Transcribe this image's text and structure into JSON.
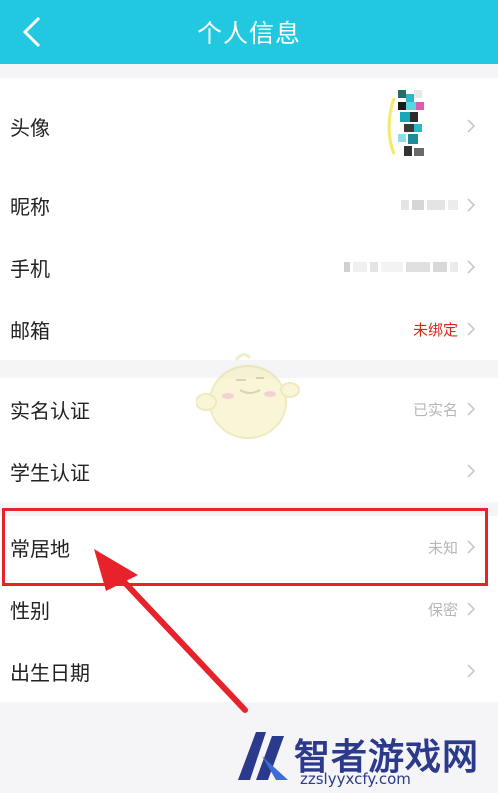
{
  "header": {
    "title": "个人信息"
  },
  "rows_top": [
    {
      "label": "头像",
      "value": ""
    },
    {
      "label": "昵称",
      "value": ""
    },
    {
      "label": "手机",
      "value": ""
    },
    {
      "label": "邮箱",
      "value": "未绑定"
    }
  ],
  "rows_mid": [
    {
      "label": "实名认证",
      "value": "已实名"
    },
    {
      "label": "学生认证",
      "value": ""
    }
  ],
  "rows_bottom": [
    {
      "label": "常居地",
      "value": "未知"
    },
    {
      "label": "性别",
      "value": "保密"
    },
    {
      "label": "出生日期",
      "value": ""
    }
  ],
  "watermark": {
    "name": "智者游戏网",
    "url": "zzslyyxcfy.com"
  },
  "colors": {
    "header": "#22c8e0",
    "highlight": "#e8222a",
    "unbound": "#d9261c"
  }
}
